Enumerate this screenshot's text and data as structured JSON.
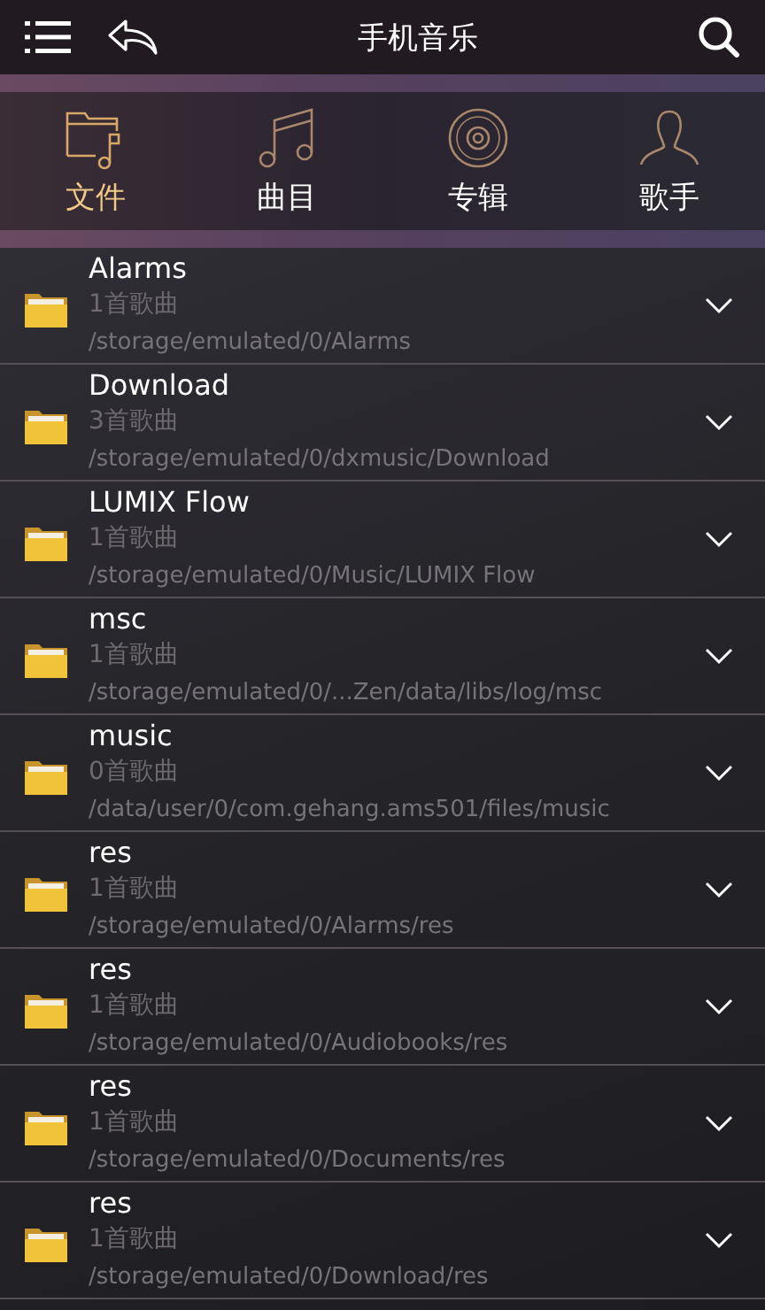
{
  "header": {
    "title": "手机音乐"
  },
  "tabs": [
    {
      "label": "文件",
      "kind": "folder",
      "selected": true
    },
    {
      "label": "曲目",
      "kind": "note",
      "selected": false
    },
    {
      "label": "专辑",
      "kind": "disc",
      "selected": false
    },
    {
      "label": "歌手",
      "kind": "person",
      "selected": false
    }
  ],
  "folders": [
    {
      "name": "Alarms",
      "count": "1首歌曲",
      "path": "/storage/emulated/0/Alarms"
    },
    {
      "name": "Download",
      "count": "3首歌曲",
      "path": "/storage/emulated/0/dxmusic/Download"
    },
    {
      "name": "LUMIX Flow",
      "count": "1首歌曲",
      "path": "/storage/emulated/0/Music/LUMIX Flow"
    },
    {
      "name": "msc",
      "count": "1首歌曲",
      "path": "/storage/emulated/0/...Zen/data/libs/log/msc"
    },
    {
      "name": "music",
      "count": "0首歌曲",
      "path": "/data/user/0/com.gehang.ams501/files/music"
    },
    {
      "name": "res",
      "count": "1首歌曲",
      "path": "/storage/emulated/0/Alarms/res"
    },
    {
      "name": "res",
      "count": "1首歌曲",
      "path": "/storage/emulated/0/Audiobooks/res"
    },
    {
      "name": "res",
      "count": "1首歌曲",
      "path": "/storage/emulated/0/Documents/res"
    },
    {
      "name": "res",
      "count": "1首歌曲",
      "path": "/storage/emulated/0/Download/res"
    }
  ]
}
